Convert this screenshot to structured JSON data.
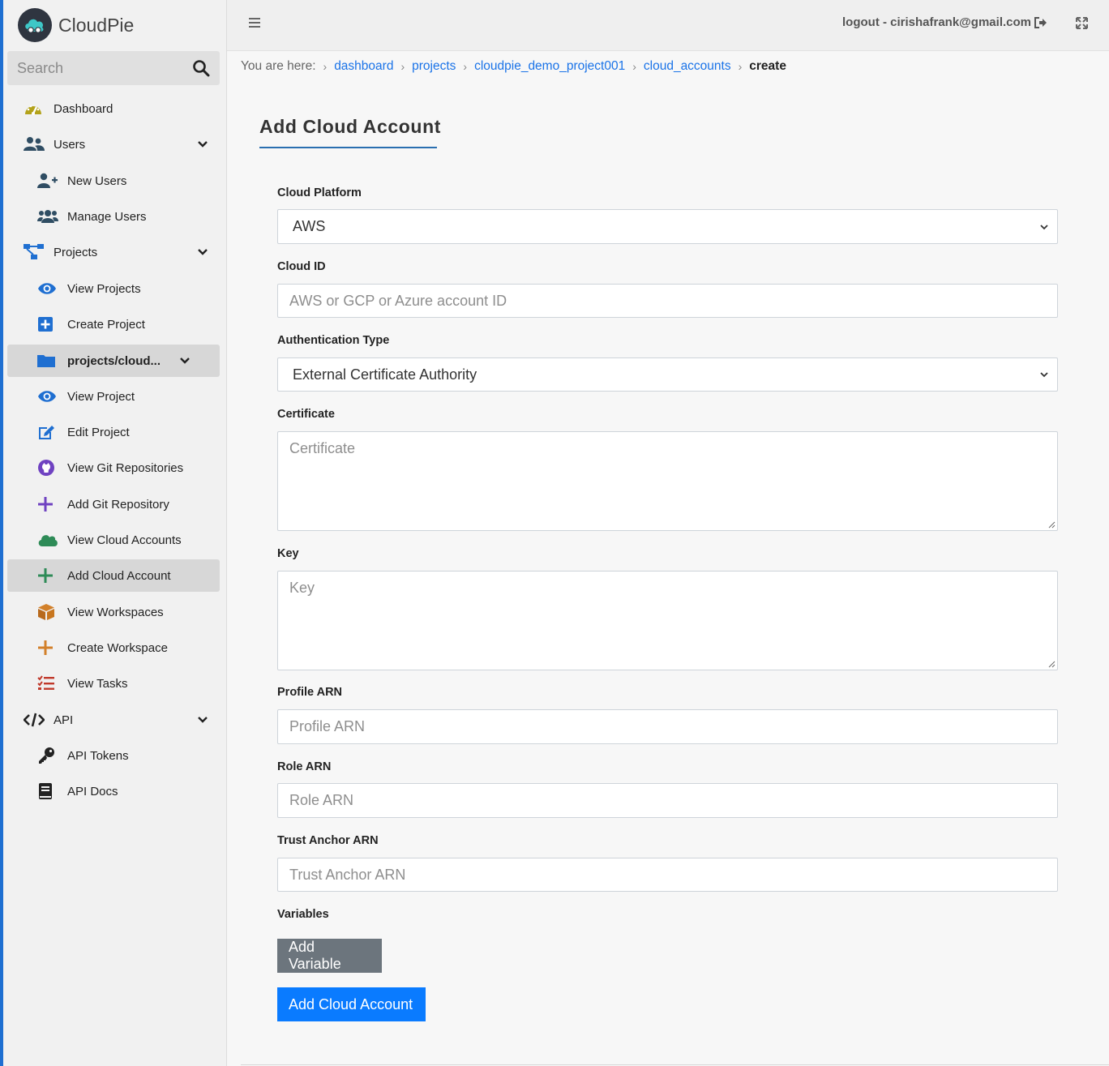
{
  "brand": {
    "name": "CloudPie"
  },
  "search": {
    "placeholder": "Search"
  },
  "sidebar": {
    "items": [
      {
        "label": "Dashboard"
      },
      {
        "label": "Users"
      },
      {
        "label": "New Users"
      },
      {
        "label": "Manage Users"
      },
      {
        "label": "Projects"
      },
      {
        "label": "View Projects"
      },
      {
        "label": "Create Project"
      },
      {
        "label": "projects/cloud..."
      },
      {
        "label": "View Project"
      },
      {
        "label": "Edit Project"
      },
      {
        "label": "View Git Repositories"
      },
      {
        "label": "Add Git Repository"
      },
      {
        "label": "View Cloud Accounts"
      },
      {
        "label": "Add Cloud Account"
      },
      {
        "label": "View Workspaces"
      },
      {
        "label": "Create Workspace"
      },
      {
        "label": "View Tasks"
      },
      {
        "label": "API"
      },
      {
        "label": "API Tokens"
      },
      {
        "label": "API Docs"
      }
    ]
  },
  "topbar": {
    "logout": "logout - cirishafrank@gmail.com"
  },
  "breadcrumb": {
    "prefix": "You are here:",
    "links": [
      "dashboard",
      "projects",
      "cloudpie_demo_project001",
      "cloud_accounts"
    ],
    "current": "create"
  },
  "form": {
    "title": "Add Cloud Account",
    "cloud_platform": {
      "label": "Cloud Platform",
      "value": "AWS"
    },
    "cloud_id": {
      "label": "Cloud ID",
      "placeholder": "AWS or GCP or Azure account ID"
    },
    "auth_type": {
      "label": "Authentication Type",
      "value": "External Certificate Authority"
    },
    "certificate": {
      "label": "Certificate",
      "placeholder": "Certificate"
    },
    "key": {
      "label": "Key",
      "placeholder": "Key"
    },
    "profile_arn": {
      "label": "Profile ARN",
      "placeholder": "Profile ARN"
    },
    "role_arn": {
      "label": "Role ARN",
      "placeholder": "Role ARN"
    },
    "trust_anchor_arn": {
      "label": "Trust Anchor ARN",
      "placeholder": "Trust Anchor ARN"
    },
    "variables": {
      "label": "Variables"
    },
    "add_variable_button": "Add Variable",
    "submit_button": "Add Cloud Account"
  },
  "colors": {
    "accent_blue": "#0a7bff",
    "secondary_gray": "#6c757d",
    "link_blue": "#1a73e8",
    "sidebar_edge": "#1f6fd1"
  },
  "icons": [
    "cloudpie-logo-icon",
    "search-icon",
    "dashboard-gauge-icon",
    "users-icon",
    "user-plus-icon",
    "users-cog-icon",
    "project-diagram-icon",
    "eye-icon",
    "plus-square-icon",
    "folder-icon",
    "edit-icon",
    "github-icon",
    "plus-icon",
    "cloud-icon",
    "box-icon",
    "tasks-icon",
    "code-icon",
    "key-icon",
    "book-icon",
    "chevron-down-icon",
    "hamburger-icon",
    "sign-out-icon",
    "expand-icon"
  ]
}
